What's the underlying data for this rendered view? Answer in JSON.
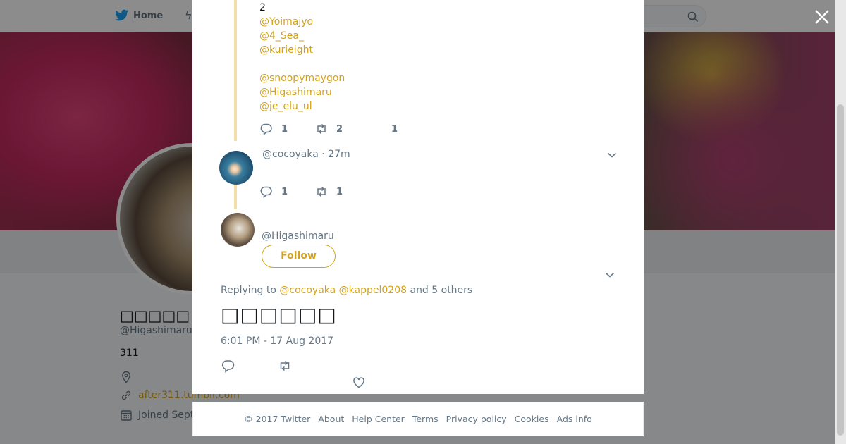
{
  "colors": {
    "accent": "#d3a21c",
    "text": "#14171a",
    "muted": "#657786",
    "thread": "#f3deaa"
  },
  "background": {
    "nav": {
      "home_label": "Home"
    },
    "profile": {
      "name": "□□□□□",
      "handle": "@Higashimaru",
      "bio": "311",
      "website": "after311.tumblr.com",
      "joined": "Joined Sept"
    }
  },
  "thread": {
    "count_line": "2",
    "mentions": [
      "@Yoimajyo",
      "@4_Sea_",
      "@kurieight",
      "",
      "@snoopymaygon",
      "@Higashimaru",
      "@je_elu_ul"
    ],
    "tweet1_actions": {
      "replies": "1",
      "retweets": "2",
      "likes": "1"
    },
    "tweet2": {
      "handle": "@cocoyaka",
      "separator": "·",
      "age": "27m",
      "actions": {
        "replies": "1",
        "retweets": "1"
      }
    }
  },
  "main_tweet": {
    "handle": "@Higashimaru",
    "follow_label": "Follow",
    "replying_prefix": "Replying to",
    "replying_handles": "@cocoyaka @kappel0208",
    "replying_suffix": "and 5 others",
    "text": "□□□□□□",
    "timestamp": "6:01 PM - 17 Aug 2017"
  },
  "footer": {
    "links": [
      "© 2017 Twitter",
      "About",
      "Help Center",
      "Terms",
      "Privacy policy",
      "Cookies",
      "Ads info"
    ]
  },
  "icons": [
    "twitter-bird-icon",
    "bolt-icon",
    "search-icon",
    "close-icon",
    "reply-icon",
    "retweet-icon",
    "like-icon",
    "chevron-down-icon",
    "location-icon",
    "link-icon",
    "calendar-icon"
  ]
}
